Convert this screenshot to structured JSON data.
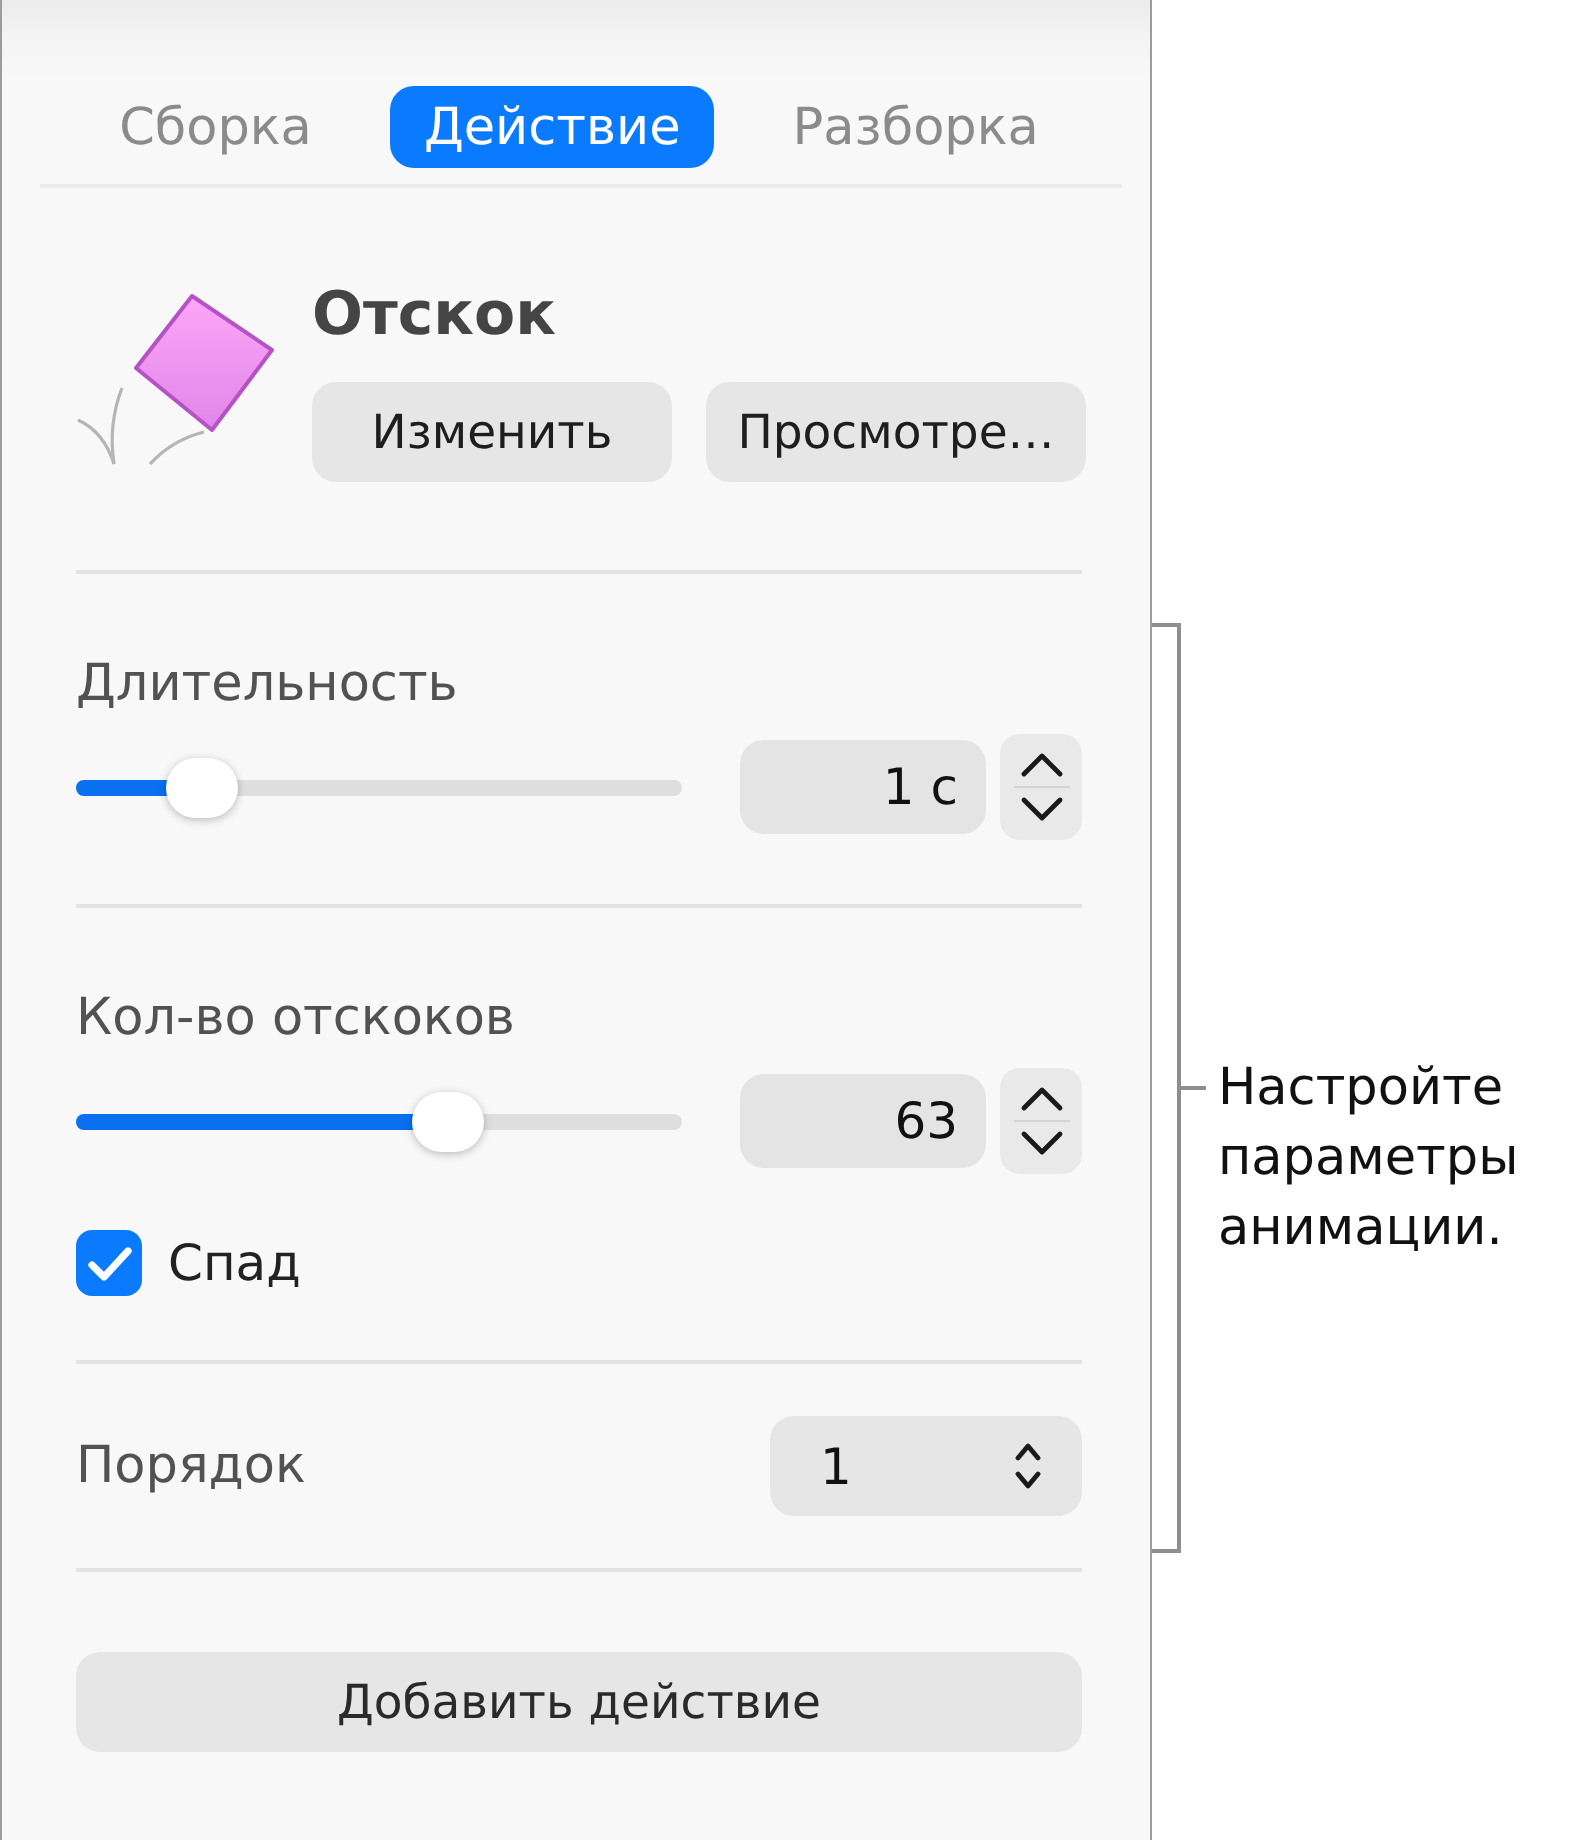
{
  "tabs": [
    {
      "label": "Сборка",
      "selected": false
    },
    {
      "label": "Действие",
      "selected": true
    },
    {
      "label": "Разборка",
      "selected": false
    }
  ],
  "effect": {
    "title": "Отскок",
    "buttons": [
      "Изменить",
      "Просмотре…"
    ]
  },
  "sections": [
    {
      "items": [
        {
          "kind": "slider",
          "label": "Длительность",
          "level": 0.17,
          "value": "1 с"
        }
      ]
    },
    {
      "items": [
        {
          "kind": "slider",
          "label": "Кол-во отскоков",
          "level": 0.63,
          "value": "63"
        },
        {
          "kind": "checkbox",
          "label": "Спад",
          "checked": true
        }
      ]
    },
    {
      "items": [
        {
          "kind": "select",
          "label": "Порядок",
          "value": "1"
        }
      ]
    }
  ],
  "add_button": "Добавить действие",
  "callout": {
    "text": "Настройте параметры анимации."
  }
}
